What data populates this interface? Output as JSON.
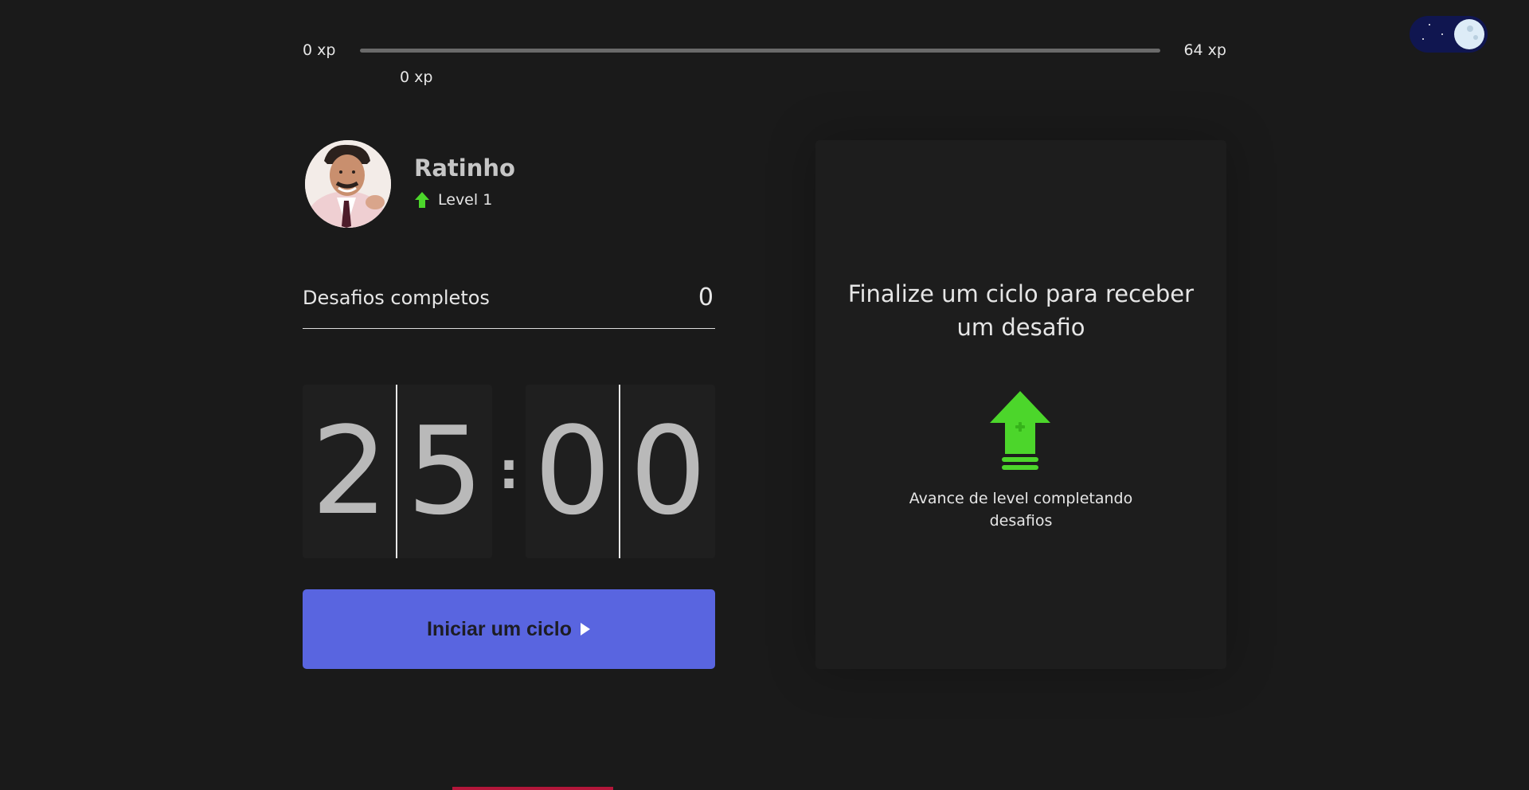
{
  "xp_bar": {
    "min_label": "0 xp",
    "max_label": "64 xp",
    "current_label": "0 xp",
    "progress_percent": 0
  },
  "theme_toggle": {
    "mode": "dark",
    "icon": "moon-icon"
  },
  "profile": {
    "name": "Ratinho",
    "level_label": "Level 1",
    "level_icon": "level-up-arrow-icon",
    "avatar_icon": "avatar"
  },
  "completed_challenges": {
    "label": "Desafios completos",
    "count": "0"
  },
  "countdown": {
    "minute_left": "2",
    "minute_right": "5",
    "separator": ":",
    "second_left": "0",
    "second_right": "0"
  },
  "start_button": {
    "label": "Iniciar um ciclo",
    "icon": "play-icon"
  },
  "challenge_box": {
    "title": "Finalize um ciclo para receber um desafio",
    "hint": "Avance de level completando desafios",
    "icon": "level-up-icon"
  },
  "colors": {
    "background": "#1a1a1a",
    "accent_green": "#4cd62b",
    "button_blue": "#5965e0",
    "toggle_navy": "#101650",
    "bottom_accent": "#b3163a"
  }
}
